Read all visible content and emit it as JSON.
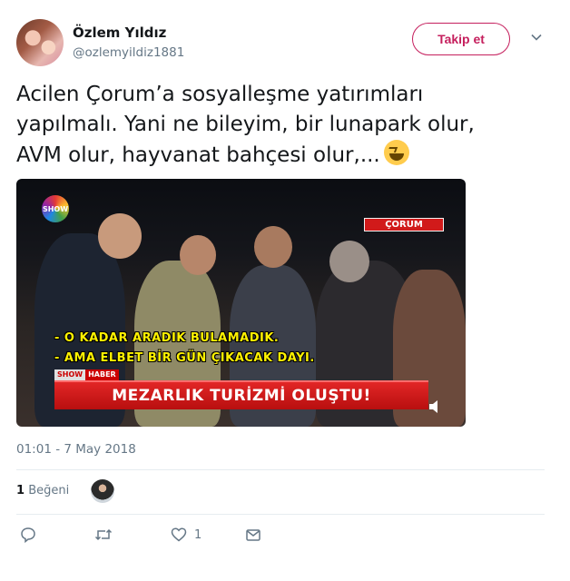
{
  "user": {
    "display_name": "Özlem Yıldız",
    "handle": "@ozlemyildiz1881",
    "follow_label": "Takip et"
  },
  "tweet": {
    "text_line1": "Acilen Çorum’a sosyalleşme yatırımları",
    "text_line2": "yapılmalı. Yani ne bileyim, bir lunapark olur,",
    "text_line3": "AVM olur, hayvanat bahçesi olur,...",
    "emoji": "grinning-squinting-face",
    "timestamp": "01:01 - 7 May 2018"
  },
  "media": {
    "channel_logo": "SHOW",
    "location_tag": "ÇORUM",
    "caption_line1": "- O KADAR ARADIK BULAMADIK.",
    "caption_line2": "- AMA ELBET BİR GÜN ÇIKACAK DAYI.",
    "brand_show": "SHOW",
    "brand_haber": "HABER",
    "banner": "MEZARLIK TURİZMİ OLUŞTU!"
  },
  "engagement": {
    "likes_count": "1",
    "likes_label": "Beğeni",
    "like_action_count": "1"
  },
  "colors": {
    "follow_accent": "#c51f5d",
    "muted_text": "#657786",
    "banner_red": "#d11a1a",
    "caption_yellow": "#fff200"
  }
}
